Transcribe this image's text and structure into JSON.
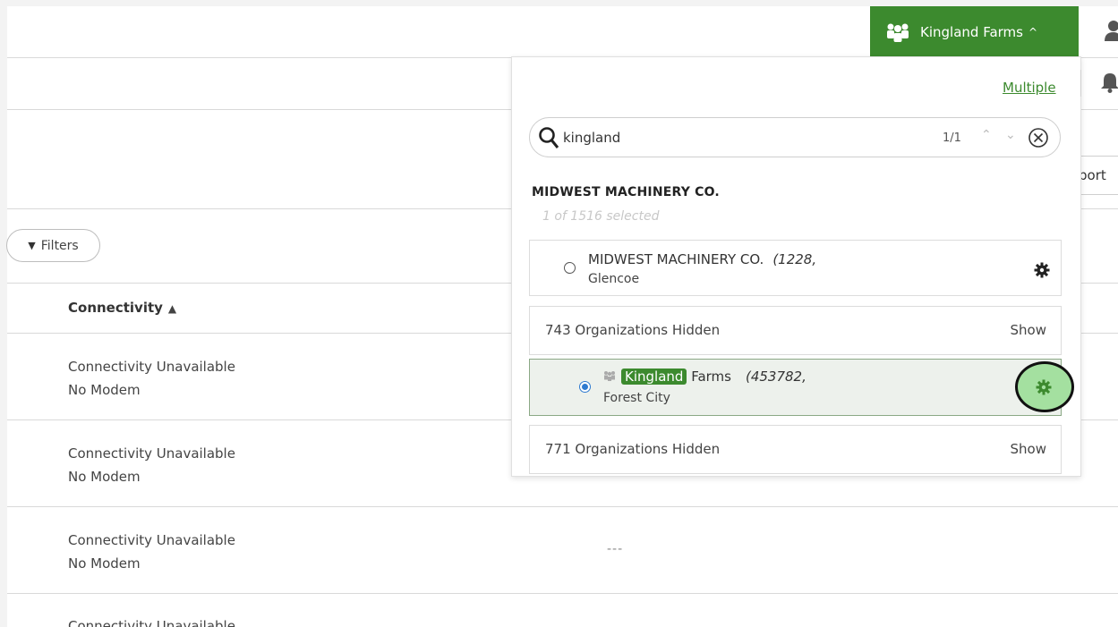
{
  "header": {
    "org_button_label": "Kingland Farms",
    "org_button_caret": "^"
  },
  "org_dropdown": {
    "multiple_link": "Multiple",
    "search": {
      "value": "kingland",
      "match_count": "1/1"
    },
    "group": {
      "title": "MIDWEST MACHINERY CO.",
      "subtitle": "1 of 1516 selected"
    },
    "items": [
      {
        "name": "MIDWEST MACHINERY CO.",
        "id": "(1228,",
        "city": "Glencoe",
        "selected": false
      },
      {
        "hidden_label": "743 Organizations Hidden",
        "show_label": "Show"
      },
      {
        "name_highlight": "Kingland",
        "name_rest": "Farms",
        "id": "(453782,",
        "city": "Forest City",
        "selected": true
      },
      {
        "hidden_label": "771 Organizations Hidden",
        "show_label": "Show"
      }
    ]
  },
  "toolbar": {
    "export_fragment": "port",
    "filters_label": "Filters"
  },
  "table": {
    "column_header": "Connectivity",
    "rows": [
      {
        "status": "Connectivity Unavailable",
        "detail": "No Modem"
      },
      {
        "status": "Connectivity Unavailable",
        "detail": "No Modem"
      },
      {
        "status": "Connectivity Unavailable",
        "detail": "No Modem",
        "extra": "---"
      },
      {
        "status": "Connectivity Unavailable"
      }
    ]
  },
  "colors": {
    "brand_green": "#3c8a2e",
    "highlight_circle": "#a4e0a0",
    "radio_blue": "#2f7bd0"
  },
  "icons": [
    "org-group-icon",
    "person-icon",
    "bell-icon",
    "search-icon",
    "clear-circle-x-icon",
    "gear-icon",
    "funnel-icon",
    "sort-icon"
  ]
}
